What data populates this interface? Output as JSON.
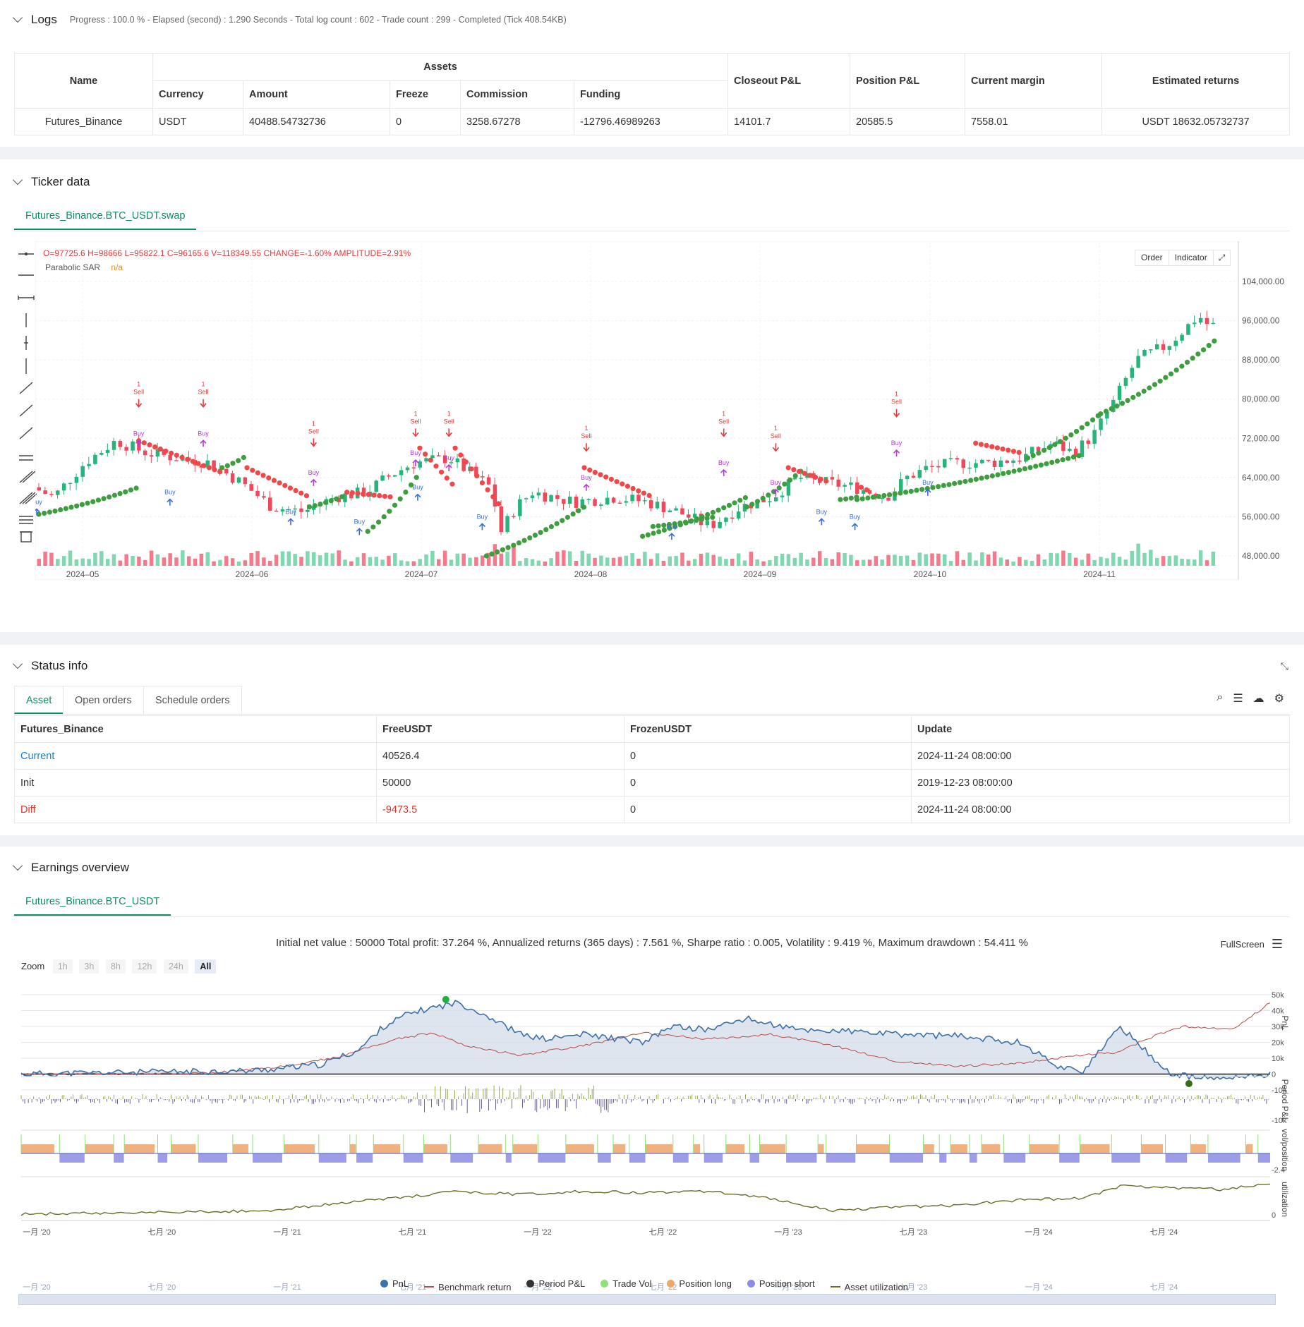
{
  "logs": {
    "title": "Logs",
    "meta": "Progress : 100.0 % - Elapsed (second) : 1.290  Seconds - Total log count : 602 - Trade count : 299 - Completed (Tick 408.54KB)",
    "headers": {
      "name": "Name",
      "assets": "Assets",
      "currency": "Currency",
      "amount": "Amount",
      "freeze": "Freeze",
      "commission": "Commission",
      "funding": "Funding",
      "closeout": "Closeout P&L",
      "position": "Position P&L",
      "margin": "Current margin",
      "returns": "Estimated returns"
    },
    "row": {
      "name": "Futures_Binance",
      "currency": "USDT",
      "amount": "40488.54732736",
      "freeze": "0",
      "commission": "3258.67278",
      "funding": "-12796.46989263",
      "closeout": "14101.7",
      "position": "20585.5",
      "margin": "7558.01",
      "returns": "USDT 18632.05732737"
    }
  },
  "ticker": {
    "title": "Ticker data",
    "tab": "Futures_Binance.BTC_USDT.swap",
    "ohlc": {
      "o": "O=97725.6",
      "h": "H=98666",
      "l": "L=95822.1",
      "c": "C=96165.6",
      "v": "V=118349.55",
      "change": "CHANGE=-1.60%",
      "amp": "AMPLITUDE=2.91%"
    },
    "indicator_name": "Parabolic SAR",
    "indicator_val": "n/a",
    "buttons": {
      "order": "Order",
      "indicator": "Indicator"
    },
    "y_ticks": [
      "104,000.00",
      "96,000.00",
      "88,000.00",
      "80,000.00",
      "72,000.00",
      "64,000.00",
      "56,000.00",
      "48,000.00"
    ],
    "x_ticks": [
      "2024–05",
      "2024–06",
      "2024–07",
      "2024–08",
      "2024–09",
      "2024–10",
      "2024–11"
    ]
  },
  "status": {
    "title": "Status info",
    "tabs": [
      "Asset",
      "Open orders",
      "Schedule orders"
    ],
    "headers": [
      "Futures_Binance",
      "FreeUSDT",
      "FrozenUSDT",
      "Update"
    ],
    "rows": [
      {
        "label": "Current",
        "free": "40526.4",
        "frozen": "0",
        "update": "2024-11-24 08:00:00"
      },
      {
        "label": "Init",
        "free": "50000",
        "frozen": "0",
        "update": "2019-12-23 08:00:00"
      },
      {
        "label": "Diff",
        "free": "-9473.5",
        "frozen": "0",
        "update": "2024-11-24 08:00:00"
      }
    ],
    "colors": {
      "current": "#1a7fd6",
      "diff": "#e0352b"
    }
  },
  "earnings": {
    "title": "Earnings overview",
    "tab": "Futures_Binance.BTC_USDT",
    "summary": "Initial net value : 50000 Total profit: 37.264 %, Annualized returns (365 days) : 7.561 %, Sharpe ratio : 0.005, Volatility : 9.419 %, Maximum drawdown : 54.411 %",
    "fullscreen": "FullScreen",
    "zoom_label": "Zoom",
    "zoom_opts": [
      "1h",
      "3h",
      "8h",
      "12h",
      "24h",
      "All"
    ],
    "pnl_ticks": [
      "50k",
      "40k",
      "30k",
      "20k",
      "10k",
      "0",
      "-10k"
    ],
    "period_ticks": [
      "-10k"
    ],
    "vol_ticks": [
      "-2.4"
    ],
    "util_ticks": [
      "0"
    ],
    "axis_titles": {
      "pnl": "PnL",
      "period": "Period P&L",
      "vol": "vol/position",
      "util": "utilization"
    },
    "x_ticks": [
      "一月 '20",
      "七月 '20",
      "一月 '21",
      "七月 '21",
      "一月 '22",
      "七月 '22",
      "一月 '23",
      "七月 '23",
      "一月 '24",
      "七月 '24"
    ],
    "legend": [
      {
        "label": "PnL",
        "color": "#3d6fa8",
        "shape": "dot"
      },
      {
        "label": "Benchmark return",
        "color": "#b84b4b",
        "shape": "line"
      },
      {
        "label": "Period P&L",
        "color": "#333333",
        "shape": "dot"
      },
      {
        "label": "Trade Vol",
        "color": "#8fe07a",
        "shape": "dot"
      },
      {
        "label": "Position long",
        "color": "#f0a868",
        "shape": "dot"
      },
      {
        "label": "Position short",
        "color": "#8c8ce6",
        "shape": "dot"
      },
      {
        "label": "Asset utilization",
        "color": "#6b6b2a",
        "shape": "line"
      }
    ]
  }
}
